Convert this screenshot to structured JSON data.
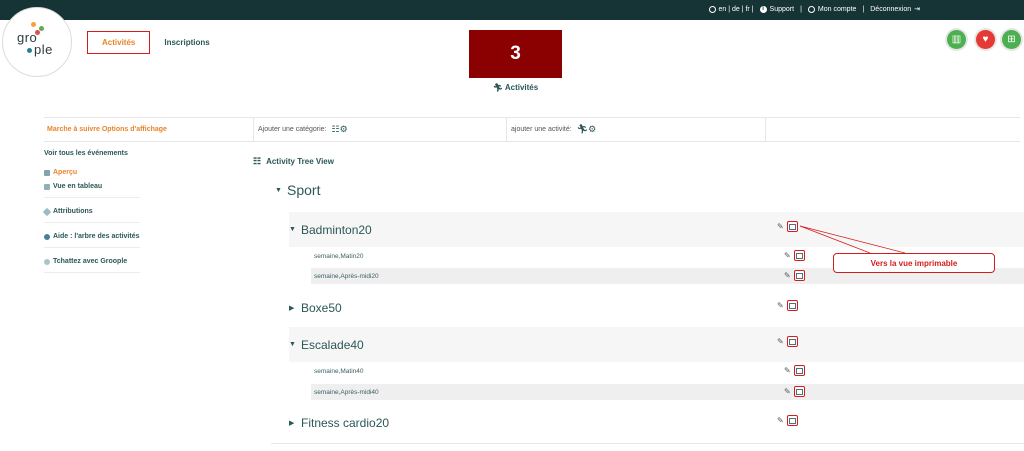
{
  "topbar": {
    "language": "en | de | fr |",
    "support": "Support",
    "account": "Mon compte",
    "logout": "Déconnexion",
    "separator": "|"
  },
  "logo": {
    "line1": "gro",
    "line2": "ple"
  },
  "nav": {
    "tabs": [
      {
        "label": "Activités",
        "active": true
      },
      {
        "label": "Inscriptions",
        "active": false
      }
    ]
  },
  "counter": {
    "value": "3",
    "label": "Activités",
    "color": "#8b0000"
  },
  "header_icons": [
    {
      "icon": "book-icon",
      "color": "#4caf50"
    },
    {
      "icon": "heart-icon",
      "color": "#e53935"
    },
    {
      "icon": "grid-icon",
      "color": "#4caf50"
    }
  ],
  "options_bar": {
    "steps": "Marche à suivre Options d'affichage",
    "add_category": "Ajouter une catégorie:",
    "add_activity": "ajouter une activité:"
  },
  "sidebar": {
    "view_all": "Voir tous les événements",
    "items": [
      {
        "label": "Aperçu",
        "icon": "tree-icon"
      },
      {
        "label": "Vue en tableau",
        "icon": "printer-icon"
      },
      {
        "label": "Attributions",
        "icon": "tag-icon"
      },
      {
        "label": "Aide : l'arbre des activités",
        "icon": "help-icon"
      },
      {
        "label": "Tchattez avec Groople",
        "icon": "chat-icon"
      }
    ]
  },
  "tree": {
    "title": "Activity Tree View",
    "root": "Sport",
    "activities": [
      {
        "name": "Badminton20",
        "expanded": true,
        "sessions": [
          "semaine,Matin20",
          "semaine,Après-midi20"
        ]
      },
      {
        "name": "Boxe50",
        "expanded": false,
        "sessions": []
      },
      {
        "name": "Escalade40",
        "expanded": true,
        "sessions": [
          "semaine,Matin40",
          "semaine,Après-midi40"
        ]
      },
      {
        "name": "Fitness cardio20",
        "expanded": false,
        "sessions": []
      }
    ]
  },
  "callout": {
    "text": "Vers la vue imprimable",
    "color": "#d41c1c"
  }
}
